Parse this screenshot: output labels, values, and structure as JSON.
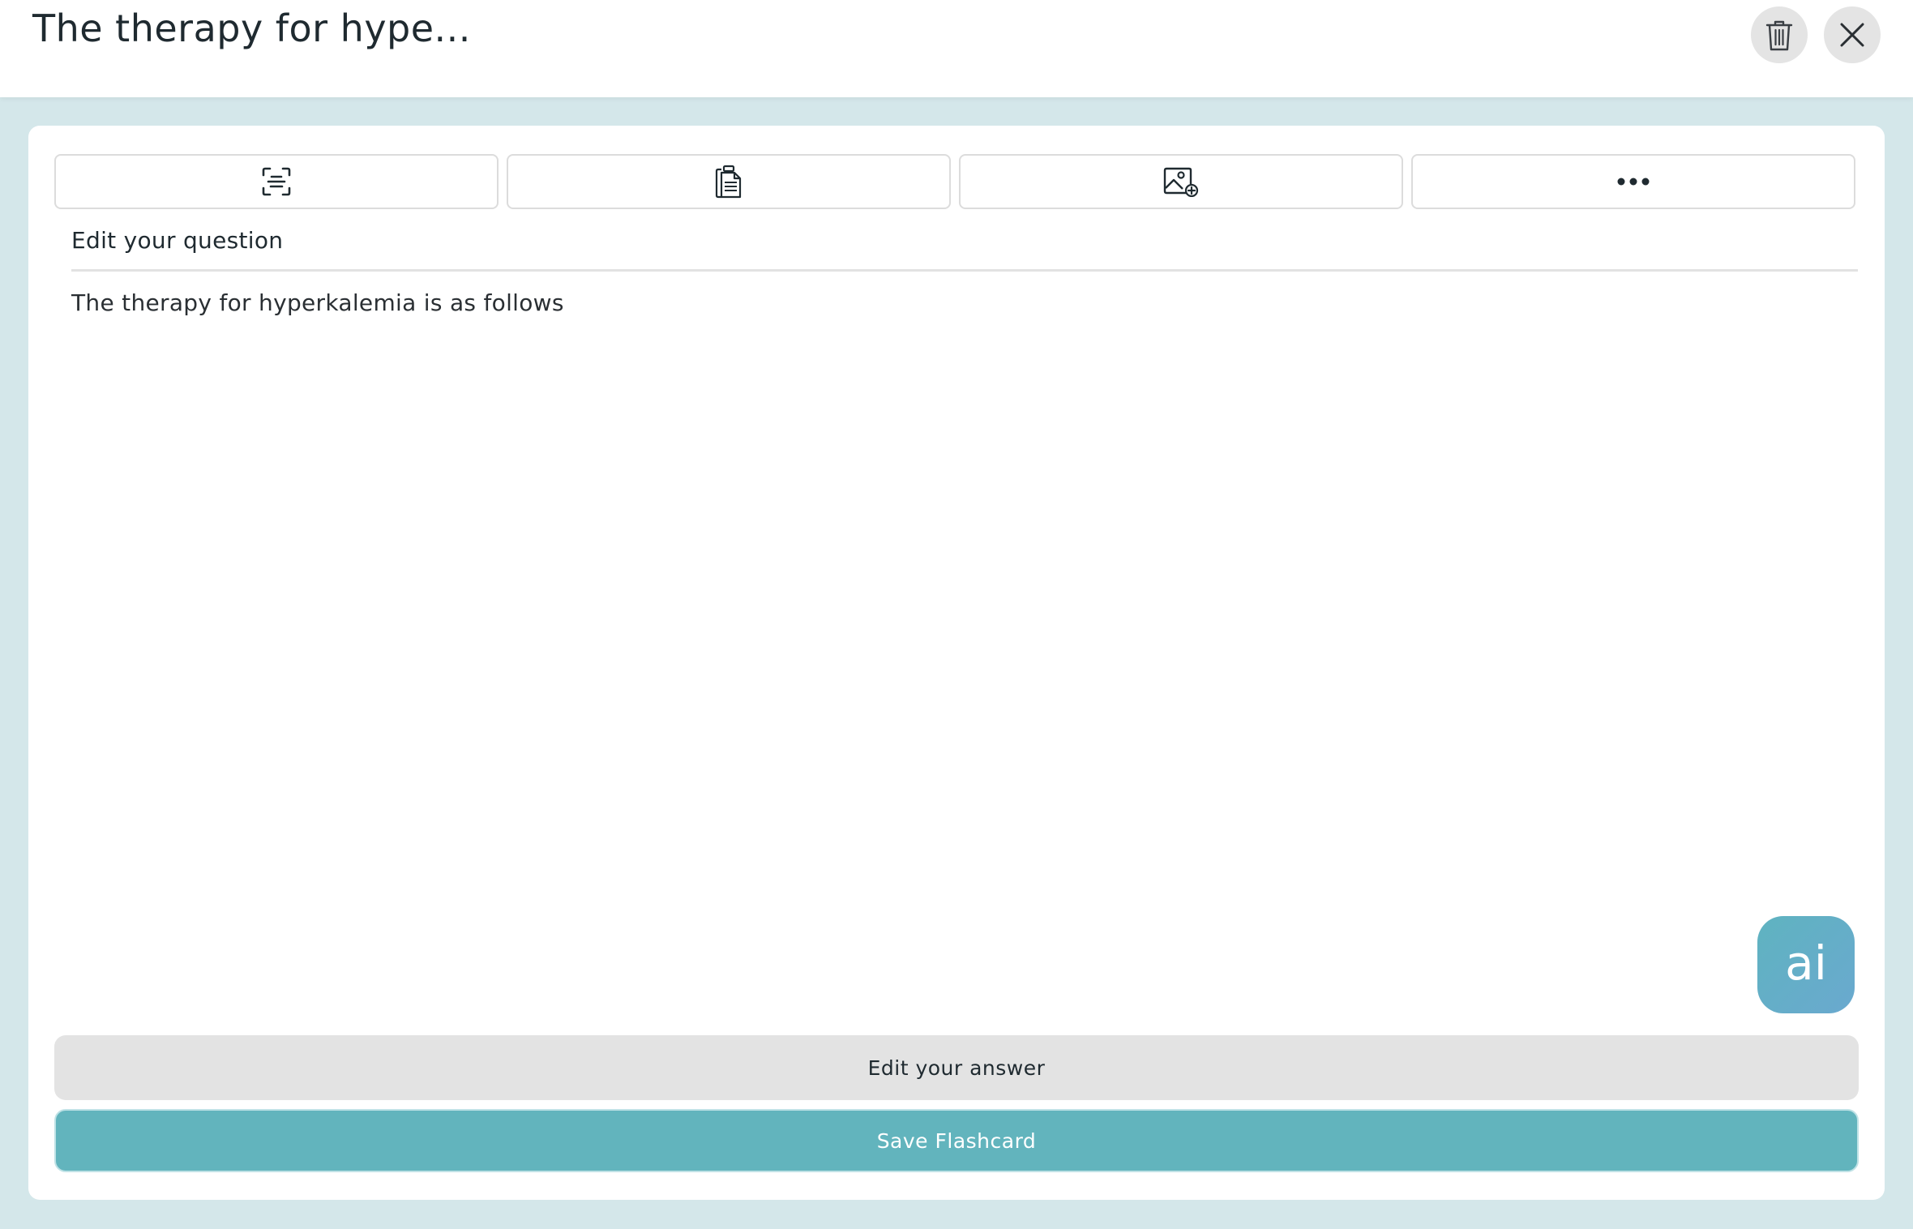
{
  "header": {
    "title": "The therapy for hype..."
  },
  "toolbar": {
    "buttons": [
      {
        "icon": "scan-text-icon"
      },
      {
        "icon": "clipboard-document-icon"
      },
      {
        "icon": "image-add-icon"
      },
      {
        "icon": "more-horizontal-icon"
      }
    ]
  },
  "question": {
    "label": "Edit your question",
    "text": "The therapy for hyperkalemia is as follows"
  },
  "ai_button": {
    "label": "ai"
  },
  "actions": {
    "edit_answer_label": "Edit your answer",
    "save_label": "Save Flashcard"
  },
  "colors": {
    "background": "#d4e7ea",
    "accent": "#62b4bd",
    "secondary_button": "#e3e3e3",
    "ai_gradient_start": "#5fb3c0",
    "ai_gradient_end": "#6aa9cf"
  }
}
